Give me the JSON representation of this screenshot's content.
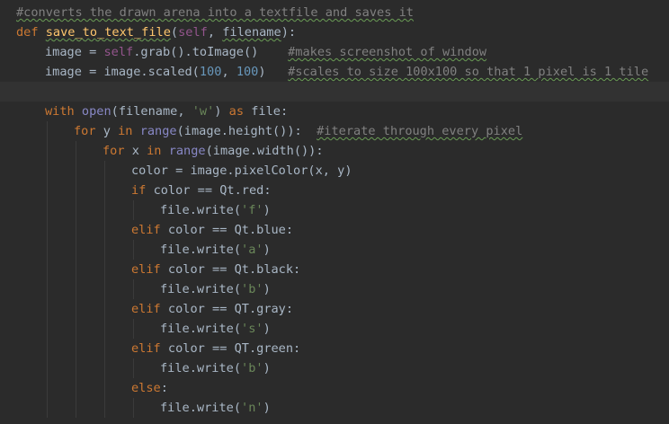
{
  "editor": {
    "lines": [
      {
        "indent": 0,
        "tokens": [
          {
            "t": "#converts the drawn arena into a textfile and saves it",
            "c": "cmt typo"
          }
        ]
      },
      {
        "indent": 0,
        "tokens": [
          {
            "t": "def ",
            "c": "kw"
          },
          {
            "t": "save_to_text_file",
            "c": "fn typo"
          },
          {
            "t": "(",
            "c": ""
          },
          {
            "t": "self",
            "c": "self"
          },
          {
            "t": ", ",
            "c": ""
          },
          {
            "t": "filename",
            "c": "param typo"
          },
          {
            "t": "):",
            "c": ""
          }
        ]
      },
      {
        "indent": 1,
        "tokens": [
          {
            "t": "image = ",
            "c": ""
          },
          {
            "t": "self",
            "c": "self"
          },
          {
            "t": ".grab().toImage()    ",
            "c": ""
          },
          {
            "t": "#makes screenshot of window",
            "c": "cmt typo"
          }
        ]
      },
      {
        "indent": 1,
        "tokens": [
          {
            "t": "image = image.scaled(",
            "c": ""
          },
          {
            "t": "100",
            "c": "num"
          },
          {
            "t": ", ",
            "c": ""
          },
          {
            "t": "100",
            "c": "num"
          },
          {
            "t": ")   ",
            "c": ""
          },
          {
            "t": "#scales to size 100x100 so that 1 pixel is 1 tile",
            "c": "cmt typo"
          }
        ]
      },
      {
        "indent": 1,
        "current": true,
        "tokens": []
      },
      {
        "indent": 1,
        "tokens": [
          {
            "t": "with ",
            "c": "kw"
          },
          {
            "t": "open",
            "c": "builtin"
          },
          {
            "t": "(filename, ",
            "c": ""
          },
          {
            "t": "'w'",
            "c": "str"
          },
          {
            "t": ") ",
            "c": ""
          },
          {
            "t": "as ",
            "c": "kw"
          },
          {
            "t": "file:",
            "c": ""
          }
        ]
      },
      {
        "indent": 2,
        "tokens": [
          {
            "t": "for ",
            "c": "kw"
          },
          {
            "t": "y ",
            "c": ""
          },
          {
            "t": "in ",
            "c": "kw"
          },
          {
            "t": "range",
            "c": "builtin"
          },
          {
            "t": "(image.height()):  ",
            "c": ""
          },
          {
            "t": "#iterate through every pixel",
            "c": "cmt typo"
          }
        ]
      },
      {
        "indent": 3,
        "tokens": [
          {
            "t": "for ",
            "c": "kw"
          },
          {
            "t": "x ",
            "c": ""
          },
          {
            "t": "in ",
            "c": "kw"
          },
          {
            "t": "range",
            "c": "builtin"
          },
          {
            "t": "(image.width()):",
            "c": ""
          }
        ]
      },
      {
        "indent": 4,
        "tokens": [
          {
            "t": "color = image.pixelColor(x, y)",
            "c": ""
          }
        ]
      },
      {
        "indent": 4,
        "tokens": [
          {
            "t": "if ",
            "c": "kw"
          },
          {
            "t": "color == Qt.red:",
            "c": ""
          }
        ]
      },
      {
        "indent": 5,
        "tokens": [
          {
            "t": "file.write(",
            "c": ""
          },
          {
            "t": "'f'",
            "c": "str"
          },
          {
            "t": ")",
            "c": ""
          }
        ]
      },
      {
        "indent": 4,
        "tokens": [
          {
            "t": "elif ",
            "c": "kw"
          },
          {
            "t": "color == Qt.blue:",
            "c": ""
          }
        ]
      },
      {
        "indent": 5,
        "tokens": [
          {
            "t": "file.write(",
            "c": ""
          },
          {
            "t": "'a'",
            "c": "str"
          },
          {
            "t": ")",
            "c": ""
          }
        ]
      },
      {
        "indent": 4,
        "tokens": [
          {
            "t": "elif ",
            "c": "kw"
          },
          {
            "t": "color == Qt.black:",
            "c": ""
          }
        ]
      },
      {
        "indent": 5,
        "tokens": [
          {
            "t": "file.write(",
            "c": ""
          },
          {
            "t": "'b'",
            "c": "str"
          },
          {
            "t": ")",
            "c": ""
          }
        ]
      },
      {
        "indent": 4,
        "tokens": [
          {
            "t": "elif ",
            "c": "kw"
          },
          {
            "t": "color == QT.gray:",
            "c": ""
          }
        ]
      },
      {
        "indent": 5,
        "tokens": [
          {
            "t": "file.write(",
            "c": ""
          },
          {
            "t": "'s'",
            "c": "str"
          },
          {
            "t": ")",
            "c": ""
          }
        ]
      },
      {
        "indent": 4,
        "tokens": [
          {
            "t": "elif ",
            "c": "kw"
          },
          {
            "t": "color == QT.green:",
            "c": ""
          }
        ]
      },
      {
        "indent": 5,
        "tokens": [
          {
            "t": "file.write(",
            "c": ""
          },
          {
            "t": "'b'",
            "c": "str"
          },
          {
            "t": ")",
            "c": ""
          }
        ]
      },
      {
        "indent": 4,
        "tokens": [
          {
            "t": "else",
            "c": "kw"
          },
          {
            "t": ":",
            "c": ""
          }
        ]
      },
      {
        "indent": 5,
        "tokens": [
          {
            "t": "file.write(",
            "c": ""
          },
          {
            "t": "'n'",
            "c": "str"
          },
          {
            "t": ")",
            "c": ""
          }
        ]
      }
    ]
  },
  "theme": {
    "background": "#2b2b2b",
    "current_line": "#323232",
    "keyword": "#cc7832",
    "function": "#ffc66d",
    "string": "#6a8759",
    "number": "#6897bb",
    "comment": "#808080",
    "self": "#94558d",
    "builtin": "#8888c6",
    "default_text": "#a9b7c6"
  }
}
